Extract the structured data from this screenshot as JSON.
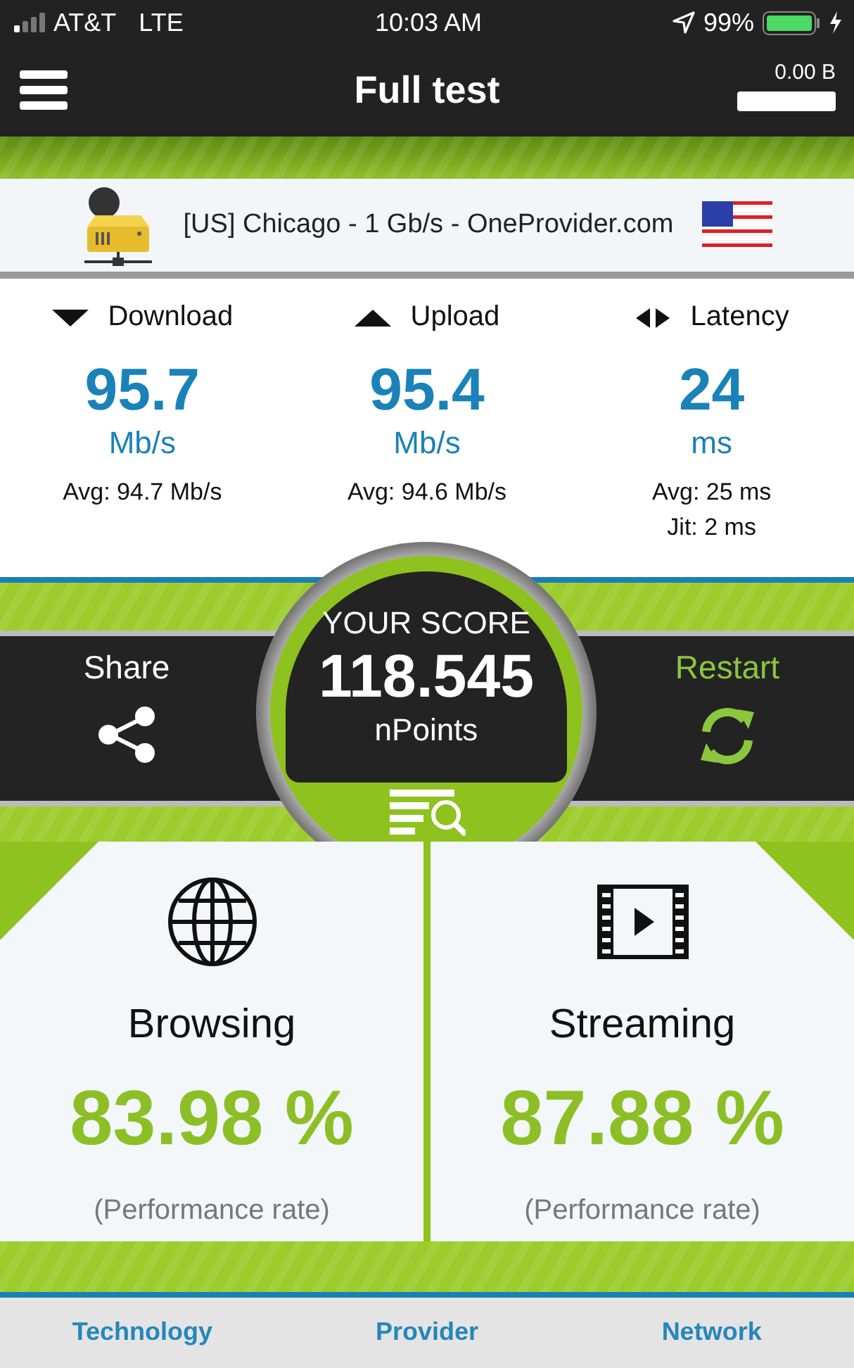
{
  "status_bar": {
    "carrier": "AT&T",
    "network": "LTE",
    "time": "10:03 AM",
    "battery": "99%"
  },
  "header": {
    "title": "Full test",
    "data_usage": "0.00 B"
  },
  "server": {
    "name": "[US] Chicago - 1 Gb/s - OneProvider.com"
  },
  "metrics": [
    {
      "kind": "download",
      "label": "Download",
      "value": "95.7",
      "unit": "Mb/s",
      "stats": [
        "Avg: 94.7 Mb/s"
      ]
    },
    {
      "kind": "upload",
      "label": "Upload",
      "value": "95.4",
      "unit": "Mb/s",
      "stats": [
        "Avg: 94.6 Mb/s"
      ]
    },
    {
      "kind": "latency",
      "label": "Latency",
      "value": "24",
      "unit": "ms",
      "stats": [
        "Avg: 25 ms",
        "Jit: 2 ms"
      ]
    }
  ],
  "score": {
    "label": "YOUR SCORE",
    "value": "118.545",
    "unit": "nPoints",
    "share": "Share",
    "restart": "Restart"
  },
  "cards": [
    {
      "kind": "browsing",
      "title": "Browsing",
      "value": "83.98 %",
      "caption": "(Performance rate)"
    },
    {
      "kind": "streaming",
      "title": "Streaming",
      "value": "87.88 %",
      "caption": "(Performance rate)"
    }
  ],
  "footer": {
    "columns": [
      "Technology",
      "Provider",
      "Network"
    ]
  }
}
